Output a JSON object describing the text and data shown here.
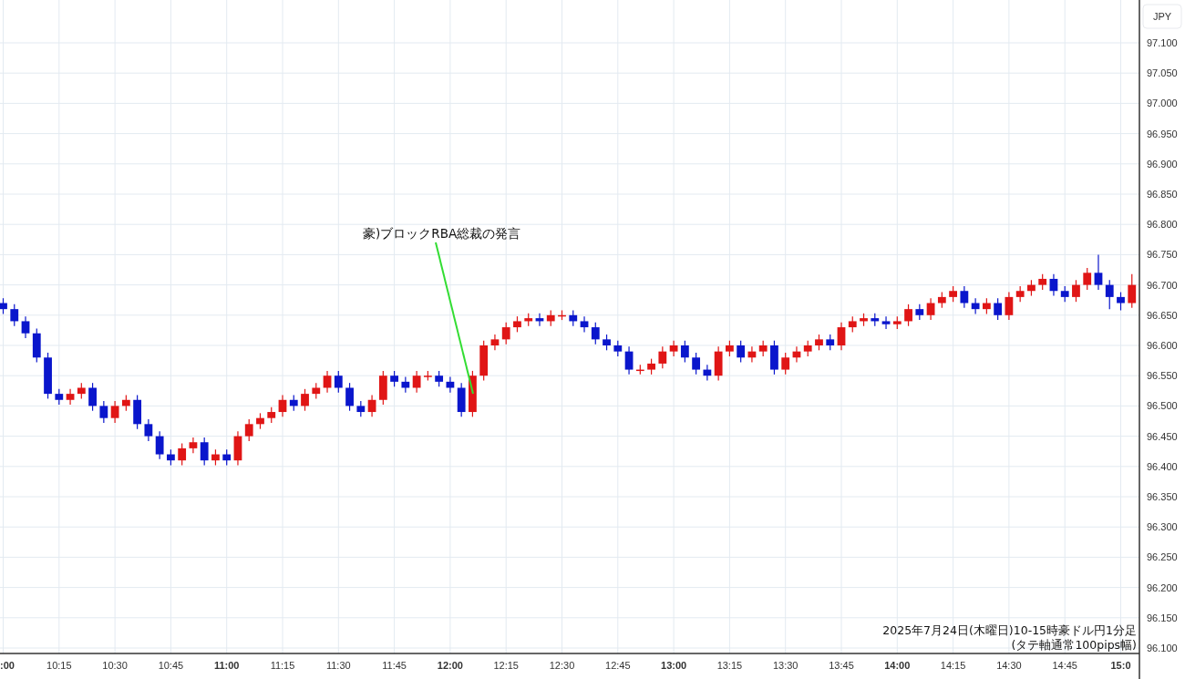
{
  "chart_data": {
    "type": "candlestick",
    "ylabel": "JPY",
    "grid": true,
    "ylim": [
      96.1,
      97.1
    ],
    "yticks": [
      {
        "value": 96.1,
        "label": "96.100"
      },
      {
        "value": 96.15,
        "label": "96.150"
      },
      {
        "value": 96.2,
        "label": "96.200"
      },
      {
        "value": 96.25,
        "label": "96.250"
      },
      {
        "value": 96.3,
        "label": "96.300"
      },
      {
        "value": 96.35,
        "label": "96.350"
      },
      {
        "value": 96.4,
        "label": "96.400"
      },
      {
        "value": 96.45,
        "label": "96.450"
      },
      {
        "value": 96.5,
        "label": "96.500"
      },
      {
        "value": 96.55,
        "label": "96.550"
      },
      {
        "value": 96.6,
        "label": "96.600"
      },
      {
        "value": 96.65,
        "label": "96.650"
      },
      {
        "value": 96.7,
        "label": "96.700"
      },
      {
        "value": 96.75,
        "label": "96.750"
      },
      {
        "value": 96.8,
        "label": "96.800"
      },
      {
        "value": 96.85,
        "label": "96.850"
      },
      {
        "value": 96.9,
        "label": "96.900"
      },
      {
        "value": 96.95,
        "label": "96.950"
      },
      {
        "value": 97.0,
        "label": "97.000"
      },
      {
        "value": 97.05,
        "label": "97.050"
      },
      {
        "value": 97.1,
        "label": "97.100"
      }
    ],
    "categories": [
      ":00",
      null,
      null,
      null,
      null,
      "10:15",
      null,
      null,
      null,
      null,
      "10:30",
      null,
      null,
      null,
      null,
      "10:45",
      null,
      null,
      null,
      null,
      "11:00",
      null,
      null,
      null,
      null,
      "11:15",
      null,
      null,
      null,
      null,
      "11:30",
      null,
      null,
      null,
      null,
      "11:45",
      null,
      null,
      null,
      null,
      "12:00",
      null,
      null,
      null,
      null,
      "12:15",
      null,
      null,
      null,
      null,
      "12:30",
      null,
      null,
      null,
      null,
      "12:45",
      null,
      null,
      null,
      null,
      "13:00",
      null,
      null,
      null,
      null,
      "13:15",
      null,
      null,
      null,
      null,
      "13:30",
      null,
      null,
      null,
      null,
      "13:45",
      null,
      null,
      null,
      null,
      "14:00",
      null,
      null,
      null,
      null,
      "14:15",
      null,
      null,
      null,
      null,
      "14:30",
      null,
      null,
      null,
      null,
      "14:45",
      null,
      null,
      null,
      null,
      "15:0",
      null
    ],
    "ohlc": [
      [
        96.67,
        96.678,
        96.652,
        96.66
      ],
      [
        96.66,
        96.668,
        96.632,
        96.64
      ],
      [
        96.64,
        96.648,
        96.612,
        96.62
      ],
      [
        96.62,
        96.628,
        96.572,
        96.58
      ],
      [
        96.58,
        96.588,
        96.512,
        96.52
      ],
      [
        96.52,
        96.528,
        96.502,
        96.51
      ],
      [
        96.51,
        96.528,
        96.502,
        96.52
      ],
      [
        96.52,
        96.538,
        96.512,
        96.53
      ],
      [
        96.53,
        96.538,
        96.492,
        96.5
      ],
      [
        96.5,
        96.508,
        96.472,
        96.48
      ],
      [
        96.48,
        96.508,
        96.472,
        96.5
      ],
      [
        96.5,
        96.518,
        96.492,
        96.51
      ],
      [
        96.51,
        96.518,
        96.462,
        96.47
      ],
      [
        96.47,
        96.478,
        96.442,
        96.45
      ],
      [
        96.45,
        96.458,
        96.412,
        96.42
      ],
      [
        96.42,
        96.428,
        96.402,
        96.41
      ],
      [
        96.41,
        96.438,
        96.402,
        96.43
      ],
      [
        96.43,
        96.448,
        96.422,
        96.44
      ],
      [
        96.44,
        96.448,
        96.402,
        96.41
      ],
      [
        96.41,
        96.428,
        96.402,
        96.42
      ],
      [
        96.42,
        96.428,
        96.402,
        96.41
      ],
      [
        96.41,
        96.458,
        96.402,
        96.45
      ],
      [
        96.45,
        96.478,
        96.442,
        96.47
      ],
      [
        96.47,
        96.488,
        96.462,
        96.48
      ],
      [
        96.48,
        96.498,
        96.472,
        96.49
      ],
      [
        96.49,
        96.518,
        96.482,
        96.51
      ],
      [
        96.51,
        96.518,
        96.492,
        96.5
      ],
      [
        96.5,
        96.528,
        96.492,
        96.52
      ],
      [
        96.52,
        96.538,
        96.512,
        96.53
      ],
      [
        96.53,
        96.558,
        96.522,
        96.55
      ],
      [
        96.55,
        96.558,
        96.522,
        96.53
      ],
      [
        96.53,
        96.538,
        96.492,
        96.5
      ],
      [
        96.5,
        96.508,
        96.482,
        96.49
      ],
      [
        96.49,
        96.518,
        96.482,
        96.51
      ],
      [
        96.51,
        96.558,
        96.502,
        96.55
      ],
      [
        96.55,
        96.558,
        96.532,
        96.54
      ],
      [
        96.54,
        96.548,
        96.522,
        96.53
      ],
      [
        96.53,
        96.558,
        96.522,
        96.55
      ],
      [
        96.55,
        96.558,
        96.542,
        96.55
      ],
      [
        96.55,
        96.558,
        96.532,
        96.54
      ],
      [
        96.54,
        96.548,
        96.522,
        96.53
      ],
      [
        96.53,
        96.538,
        96.482,
        96.49
      ],
      [
        96.49,
        96.558,
        96.482,
        96.55
      ],
      [
        96.55,
        96.608,
        96.542,
        96.6
      ],
      [
        96.6,
        96.618,
        96.592,
        96.61
      ],
      [
        96.61,
        96.638,
        96.602,
        96.63
      ],
      [
        96.63,
        96.648,
        96.622,
        96.64
      ],
      [
        96.64,
        96.653,
        96.632,
        96.645
      ],
      [
        96.645,
        96.653,
        96.632,
        96.64
      ],
      [
        96.64,
        96.658,
        96.632,
        96.65
      ],
      [
        96.65,
        96.658,
        96.642,
        96.65
      ],
      [
        96.65,
        96.658,
        96.632,
        96.64
      ],
      [
        96.64,
        96.648,
        96.622,
        96.63
      ],
      [
        96.63,
        96.638,
        96.602,
        96.61
      ],
      [
        96.61,
        96.618,
        96.592,
        96.6
      ],
      [
        96.6,
        96.608,
        96.582,
        96.59
      ],
      [
        96.59,
        96.598,
        96.552,
        96.56
      ],
      [
        96.56,
        96.568,
        96.552,
        96.56
      ],
      [
        96.56,
        96.578,
        96.552,
        96.57
      ],
      [
        96.57,
        96.598,
        96.562,
        96.59
      ],
      [
        96.59,
        96.608,
        96.582,
        96.6
      ],
      [
        96.6,
        96.608,
        96.572,
        96.58
      ],
      [
        96.58,
        96.588,
        96.552,
        96.56
      ],
      [
        96.56,
        96.568,
        96.542,
        96.55
      ],
      [
        96.55,
        96.598,
        96.542,
        96.59
      ],
      [
        96.59,
        96.608,
        96.582,
        96.6
      ],
      [
        96.6,
        96.608,
        96.572,
        96.58
      ],
      [
        96.58,
        96.598,
        96.572,
        96.59
      ],
      [
        96.59,
        96.608,
        96.582,
        96.6
      ],
      [
        96.6,
        96.608,
        96.552,
        96.56
      ],
      [
        96.56,
        96.588,
        96.552,
        96.58
      ],
      [
        96.58,
        96.598,
        96.572,
        96.59
      ],
      [
        96.59,
        96.608,
        96.582,
        96.6
      ],
      [
        96.6,
        96.618,
        96.592,
        96.61
      ],
      [
        96.61,
        96.618,
        96.592,
        96.6
      ],
      [
        96.6,
        96.638,
        96.592,
        96.63
      ],
      [
        96.63,
        96.648,
        96.622,
        96.64
      ],
      [
        96.64,
        96.653,
        96.632,
        96.645
      ],
      [
        96.645,
        96.653,
        96.632,
        96.64
      ],
      [
        96.64,
        96.648,
        96.627,
        96.635
      ],
      [
        96.635,
        96.648,
        96.627,
        96.64
      ],
      [
        96.64,
        96.668,
        96.632,
        96.66
      ],
      [
        96.66,
        96.668,
        96.642,
        96.65
      ],
      [
        96.65,
        96.678,
        96.642,
        96.67
      ],
      [
        96.67,
        96.688,
        96.662,
        96.68
      ],
      [
        96.68,
        96.698,
        96.672,
        96.69
      ],
      [
        96.69,
        96.698,
        96.662,
        96.67
      ],
      [
        96.67,
        96.678,
        96.652,
        96.66
      ],
      [
        96.66,
        96.678,
        96.652,
        96.67
      ],
      [
        96.67,
        96.678,
        96.642,
        96.65
      ],
      [
        96.65,
        96.688,
        96.642,
        96.68
      ],
      [
        96.68,
        96.698,
        96.672,
        96.69
      ],
      [
        96.69,
        96.708,
        96.682,
        96.7
      ],
      [
        96.7,
        96.718,
        96.692,
        96.71
      ],
      [
        96.71,
        96.718,
        96.682,
        96.69
      ],
      [
        96.69,
        96.698,
        96.672,
        96.68
      ],
      [
        96.68,
        96.708,
        96.672,
        96.7
      ],
      [
        96.7,
        96.728,
        96.692,
        96.72
      ],
      [
        96.72,
        96.75,
        96.692,
        96.7
      ],
      [
        96.7,
        96.708,
        96.66,
        96.68
      ],
      [
        96.68,
        96.688,
        96.658,
        96.67
      ],
      [
        96.67,
        96.718,
        96.662,
        96.7
      ]
    ],
    "annotations": [
      "豪)ブロックRBA総裁の発言"
    ]
  },
  "caption": [
    "2025年7月24日(木曜日)10-15時豪ドル円1分足",
    "(タテ軸通常100pips幅)"
  ]
}
